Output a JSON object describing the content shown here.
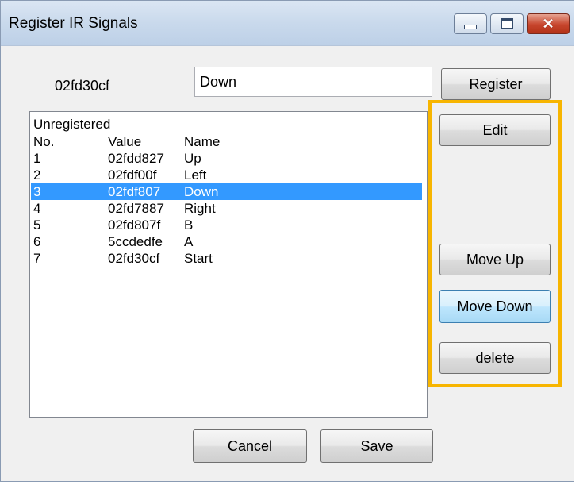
{
  "window": {
    "title": "Register IR Signals"
  },
  "form": {
    "signal_code": "02fd30cf",
    "name_value": "Down",
    "register_label": "Register"
  },
  "list": {
    "header": "Unregistered",
    "columns": [
      "No.",
      "Value",
      "Name"
    ],
    "rows": [
      {
        "no": "1",
        "value": "02fdd827",
        "name": "Up"
      },
      {
        "no": "2",
        "value": "02fdf00f",
        "name": "Left"
      },
      {
        "no": "3",
        "value": "02fdf807",
        "name": "Down"
      },
      {
        "no": "4",
        "value": "02fd7887",
        "name": "Right"
      },
      {
        "no": "5",
        "value": "02fd807f",
        "name": "B"
      },
      {
        "no": "6",
        "value": "5ccdedfe",
        "name": "A"
      },
      {
        "no": "7",
        "value": "02fd30cf",
        "name": "Start"
      }
    ],
    "selected_row": "3"
  },
  "side_buttons": {
    "edit": "Edit",
    "move_up": "Move Up",
    "move_down": "Move Down",
    "delete": "delete"
  },
  "footer": {
    "cancel": "Cancel",
    "save": "Save"
  },
  "colors": {
    "selection": "#3399ff",
    "highlight_frame": "#f7b500",
    "focused_button": "#bee6fd"
  }
}
